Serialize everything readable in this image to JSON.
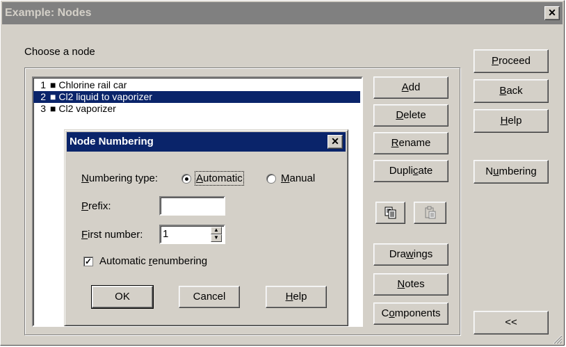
{
  "window": {
    "title": "Example: Nodes",
    "close_label": "✕"
  },
  "main": {
    "choose_label": "Choose a node",
    "nodes": [
      {
        "num": "1",
        "label": "■ Chlorine rail car",
        "selected": false
      },
      {
        "num": "2",
        "label": "■ Cl2 liquid to vaporizer",
        "selected": true
      },
      {
        "num": "3",
        "label": "■ Cl2 vaporizer",
        "selected": false
      }
    ]
  },
  "mid_buttons": {
    "add": [
      "",
      "A",
      "dd"
    ],
    "delete": [
      "",
      "D",
      "elete"
    ],
    "rename": [
      "",
      "R",
      "ename"
    ],
    "duplicate": [
      "Dupli",
      "c",
      "ate"
    ],
    "drawings": [
      "Dra",
      "w",
      "ings"
    ],
    "notes": [
      "",
      "N",
      "otes"
    ],
    "components": [
      "C",
      "o",
      "mponents"
    ]
  },
  "right_buttons": {
    "proceed": [
      "",
      "P",
      "roceed"
    ],
    "back": [
      "",
      "B",
      "ack"
    ],
    "help": [
      "",
      "H",
      "elp"
    ],
    "numbering": [
      "N",
      "u",
      "mbering"
    ],
    "collapse": "<<"
  },
  "icons": {
    "copy": "copy-icon",
    "paste": "paste-icon"
  },
  "dialog": {
    "title": "Node Numbering",
    "close_label": "✕",
    "numbering_type": [
      "",
      "N",
      "umbering type:"
    ],
    "automatic": [
      "",
      "A",
      "utomatic"
    ],
    "manual": [
      "",
      "M",
      "anual"
    ],
    "numbering_selected": "automatic",
    "prefix_label": [
      "",
      "P",
      "refix:"
    ],
    "prefix_value": "",
    "first_number_label": [
      "",
      "F",
      "irst number:"
    ],
    "first_number_value": "1",
    "auto_renumber": [
      "Automatic ",
      "r",
      "enumbering"
    ],
    "auto_renumber_checked": true,
    "ok": "OK",
    "cancel": "Cancel",
    "help": [
      "",
      "H",
      "elp"
    ]
  }
}
